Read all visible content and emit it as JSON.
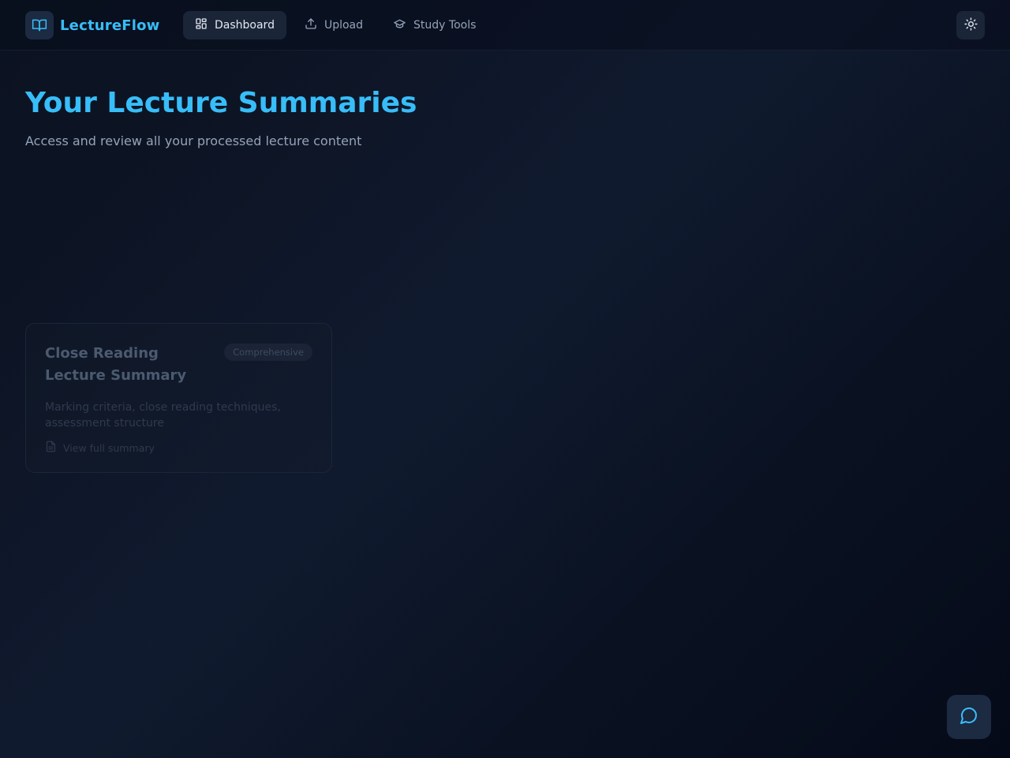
{
  "app": {
    "name": "LectureFlow"
  },
  "nav": {
    "tabs": [
      {
        "label": "Dashboard",
        "icon": "dashboard-icon",
        "active": true
      },
      {
        "label": "Upload",
        "icon": "upload-icon",
        "active": false
      },
      {
        "label": "Study Tools",
        "icon": "graduation-cap-icon",
        "active": false
      }
    ],
    "theme_toggle_icon": "sun-icon"
  },
  "header": {
    "title": "Your Lecture Summaries",
    "subtitle": "Access and review all your processed lecture content"
  },
  "summaries": [
    {
      "title": "Close Reading Lecture Summary",
      "badge": "Comprehensive",
      "description": "Marking criteria, close reading techniques, assessment structure",
      "link_label": "View full summary",
      "link_icon": "document-icon"
    }
  ],
  "chat_button": {
    "icon": "chat-bubble-icon"
  },
  "colors": {
    "accent": "#38bdf8",
    "background": "#0f172a",
    "active_tab_bg": "#1a2538"
  }
}
